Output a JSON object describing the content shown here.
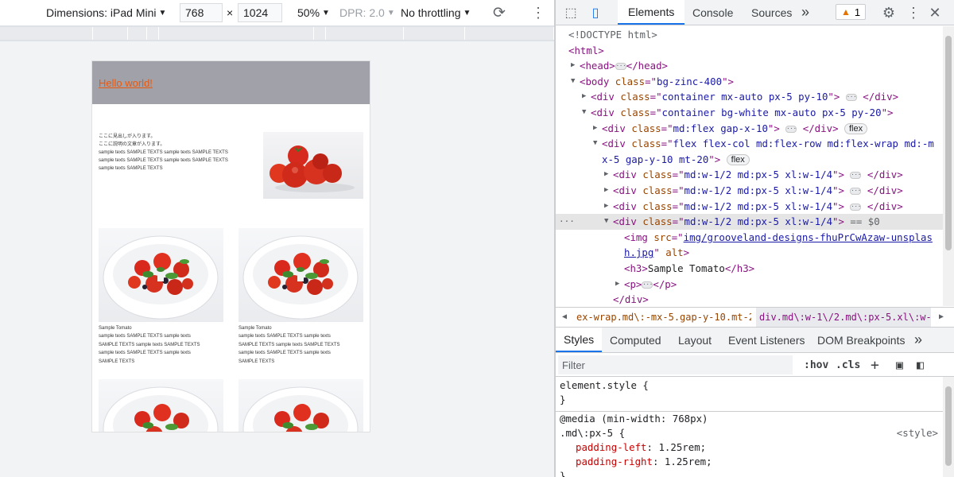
{
  "device_toolbar": {
    "dimensions_label": "Dimensions: iPad Mini",
    "width_value": "768",
    "times": "×",
    "height_value": "1024",
    "zoom": "50%",
    "dpr": "DPR: 2.0",
    "throttling": "No throttling"
  },
  "preview": {
    "header_link": "Hello world!",
    "intro_lines": [
      "ここに見出しが入ります。",
      "ここに説明の文章が入ります。",
      "sample texts SAMPLE TEXTS sample texts SAMPLE TEXTS",
      "sample texts SAMPLE TEXTS sample texts SAMPLE TEXTS",
      "sample texts SAMPLE TEXTS"
    ],
    "cards": [
      {
        "title": "Sample Tomato",
        "desc": [
          "sample texts SAMPLE TEXTS sample texts",
          "SAMPLE TEXTS sample texts SAMPLE TEXTS",
          "sample texts SAMPLE TEXTS sample texts",
          "SAMPLE TEXTS"
        ]
      },
      {
        "title": "Sample Tomato",
        "desc": [
          "sample texts SAMPLE TEXTS sample texts",
          "SAMPLE TEXTS sample texts SAMPLE TEXTS",
          "sample texts SAMPLE TEXTS sample texts",
          "SAMPLE TEXTS"
        ]
      }
    ]
  },
  "devtools": {
    "tabs": {
      "elements": "Elements",
      "console": "Console",
      "sources": "Sources",
      "more": "»"
    },
    "warnings_count": "1",
    "dom": {
      "doctype": "<!DOCTYPE html>",
      "html_open": "<html>",
      "head": {
        "open": "<head>",
        "close": "</head>"
      },
      "body": {
        "open": "<body ",
        "attr": "class",
        "eq": "=\"",
        "val": "bg-zinc-400",
        "end": "\">"
      },
      "div1": {
        "open": "<div ",
        "attr": "class",
        "val": "container mx-auto px-5 py-10",
        "close": "</div>"
      },
      "div2": {
        "open": "<div ",
        "attr": "class",
        "val": "container bg-white mx-auto px-5 py-20"
      },
      "div3": {
        "open": "<div ",
        "attr": "class",
        "val": "md:flex gap-x-10",
        "close": "</div>",
        "badge": "flex"
      },
      "div4": {
        "open": "<div ",
        "attr": "class",
        "val_a": "flex flex-col md:flex-row md:flex-wrap md:-m",
        "val_b": "x-5 gap-y-10 mt-20",
        "badge": "flex"
      },
      "child": {
        "open": "<div ",
        "attr": "class",
        "val": "md:w-1/2 md:px-5 xl:w-1/4",
        "close": "</div>"
      },
      "selected_marker": " == $0",
      "img": {
        "open": "<img ",
        "attr": "src",
        "val_a": "img/grooveland-designs-fhuPrCwAzaw-unsplas",
        "val_b": "h.jpg",
        "alt": "alt",
        "end": ">"
      },
      "h3": {
        "open": "<h3>",
        "text": "Sample Tomato",
        "close": "</h3>"
      },
      "p": {
        "open": "<p>",
        "close": "</p>"
      },
      "div_close": "</div>"
    },
    "breadcrumbs": [
      "ex-wrap.md\\:-mx-5.gap-y-10.mt-20",
      "div.md\\:w-1\\/2.md\\:px-5.xl\\:w-1\\/4"
    ],
    "styles_tabs": [
      "Styles",
      "Computed",
      "Layout",
      "Event Listeners",
      "DOM Breakpoints"
    ],
    "filter_placeholder": "Filter",
    "hov": ":hov",
    "cls": ".cls",
    "css": {
      "element_style": "element.style {",
      "close_brace": "}",
      "media": "@media (min-width: 768px)",
      "selector": ".md\\:px-5 {",
      "source": "<style>",
      "props": [
        {
          "name": "padding-left",
          "value": "1.25rem;"
        },
        {
          "name": "padding-right",
          "value": "1.25rem;"
        }
      ]
    }
  }
}
